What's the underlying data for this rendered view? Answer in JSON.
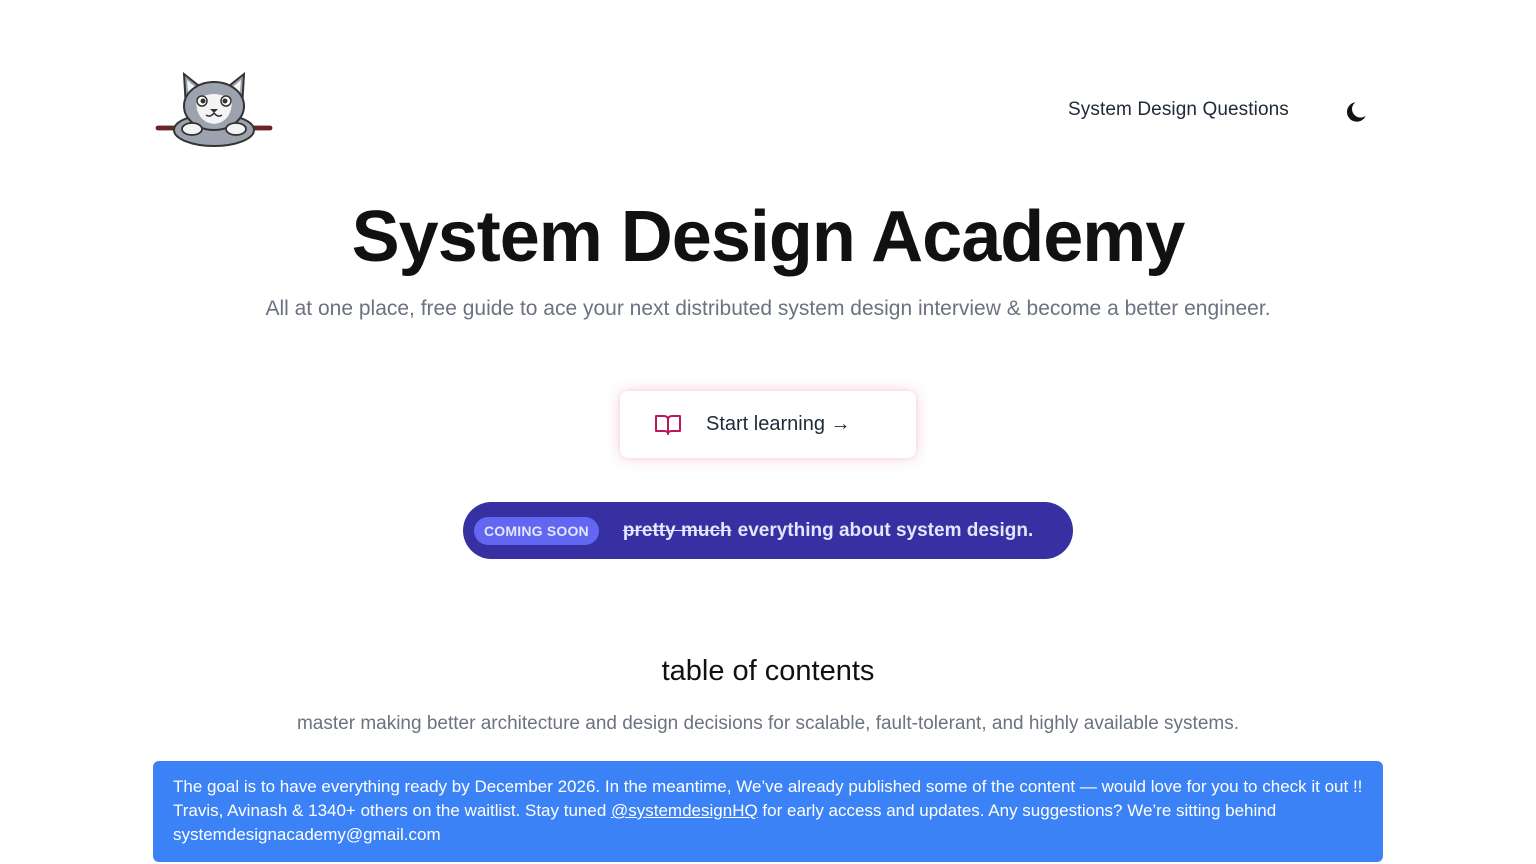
{
  "header": {
    "logo_name": "cat-mascot-logo",
    "nav_link": "System Design Questions",
    "theme_toggle_icon": "moon-icon"
  },
  "hero": {
    "title": "System Design Academy",
    "subtitle": "All at one place, free guide to ace your next distributed system design interview & become a better engineer.",
    "cta_icon": "book-icon",
    "cta_label": "Start learning →"
  },
  "banner": {
    "badge": "COMING SOON",
    "strikethrough": "pretty much",
    "text": "everything about system design."
  },
  "toc": {
    "title": "table of contents",
    "subtitle": "master making better architecture and design decisions for scalable, fault-tolerant, and highly available systems."
  },
  "notice": {
    "part1": "The goal is to have everything ready by December 2026. In the meantime, We’ve already published some of the content — would love for you to check it out !! Travis, Avinash & 1340+ others on the waitlist. Stay tuned ",
    "handle": "@systemdesignHQ",
    "part2": " for early access and updates. Any suggestions? We’re sitting behind systemdesignacademy@gmail.com"
  },
  "colors": {
    "banner_bg": "#3730a3",
    "badge_bg": "#6366f1",
    "notice_bg": "#3b82f6",
    "cta_icon": "#be185d"
  }
}
